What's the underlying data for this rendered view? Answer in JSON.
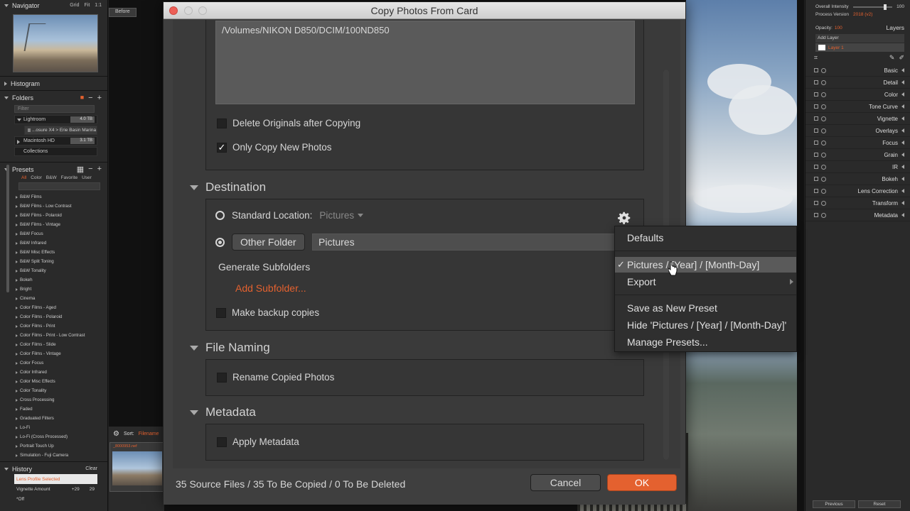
{
  "left_panel": {
    "navigator": {
      "title": "Navigator",
      "opts": [
        "Grid",
        "Fit",
        "1:1"
      ]
    },
    "histogram": {
      "title": "Histogram"
    },
    "folders": {
      "title": "Folders",
      "filter_placeholder": "Filter",
      "items": [
        {
          "name": "Lightroom",
          "size": "4.0 TB"
        },
        {
          "name": "...osure X4 > Erie Basin Marina"
        },
        {
          "name": "Macintosh HD",
          "size": "3.1 TB"
        },
        {
          "name": "Collections"
        }
      ]
    },
    "presets": {
      "title": "Presets",
      "tabs": [
        "All",
        "Color",
        "B&W",
        "Favorite",
        "User"
      ],
      "items": [
        "B&W Films",
        "B&W Films - Low Contrast",
        "B&W Films - Polaroid",
        "B&W Films - Vintage",
        "B&W Focus",
        "B&W Infrared",
        "B&W Misc Effects",
        "B&W Split Toning",
        "B&W Tonality",
        "Bokeh",
        "Bright",
        "Cinema",
        "Color Films - Aged",
        "Color Films - Polaroid",
        "Color Films - Print",
        "Color Films - Print - Low Contrast",
        "Color Films - Slide",
        "Color Films - Vintage",
        "Color Focus",
        "Color Infrared",
        "Color Misc Effects",
        "Color Tonality",
        "Cross Processing",
        "Faded",
        "Graduated Filters",
        "Lo-Fi",
        "Lo-Fi (Cross Processed)",
        "Portrait Touch Up",
        "Simulation - Fuji Camera"
      ]
    },
    "history": {
      "title": "History",
      "clear": "Clear",
      "items": [
        {
          "label": "Lens Profile Selected"
        },
        {
          "label": "Vignette Amount",
          "from": "+29",
          "to": "29"
        },
        {
          "label": "*Off"
        }
      ]
    }
  },
  "center": {
    "before_label": "Before",
    "filmstrip": {
      "sort_label": "Sort:",
      "sort_value": "Filename",
      "thumb_name": "_8000953.nef"
    }
  },
  "right_panel": {
    "overall_intensity_label": "Overall Intensity",
    "overall_intensity_value": "100",
    "process_version_label": "Process Version",
    "process_version_value": "2018 (v2)",
    "opacity_label": "Opacity:",
    "opacity_value": "100",
    "layers_title": "Layers",
    "add_layer": "Add Layer",
    "layer_name": "Layer 1",
    "modules": [
      "Basic",
      "Detail",
      "Color",
      "Tone Curve",
      "Vignette",
      "Overlays",
      "Focus",
      "Grain",
      "IR",
      "Bokeh",
      "Lens Correction",
      "Transform",
      "Metadata"
    ],
    "previous": "Previous",
    "reset": "Reset"
  },
  "dialog": {
    "title": "Copy Photos From Card",
    "source_path": "/Volumes/NIKON D850/DCIM/100ND850",
    "delete_originals": "Delete Originals after Copying",
    "only_copy_new": "Only Copy New Photos",
    "destination": {
      "title": "Destination",
      "standard_location": "Standard Location:",
      "standard_value": "Pictures",
      "other_folder_button": "Other Folder",
      "other_folder_value": "Pictures",
      "generate_subfolders": "Generate Subfolders",
      "add_subfolder": "Add Subfolder...",
      "make_backup": "Make backup copies"
    },
    "file_naming": {
      "title": "File Naming",
      "rename": "Rename Copied Photos"
    },
    "metadata": {
      "title": "Metadata",
      "apply": "Apply Metadata"
    },
    "status": "35 Source Files / 35 To Be Copied / 0 To Be Deleted",
    "cancel": "Cancel",
    "ok": "OK"
  },
  "menu": {
    "defaults": "Defaults",
    "selected": "Pictures / [Year] / [Month-Day]",
    "export": "Export",
    "save_preset": "Save as New Preset",
    "hide_preset": "Hide 'Pictures / [Year] / [Month-Day]'",
    "manage": "Manage Presets...",
    "check": "✓"
  },
  "colors": {
    "accent": "#e4612f",
    "dialog_bg": "#3a3a3a",
    "menu_bg": "#2f2f2f"
  }
}
